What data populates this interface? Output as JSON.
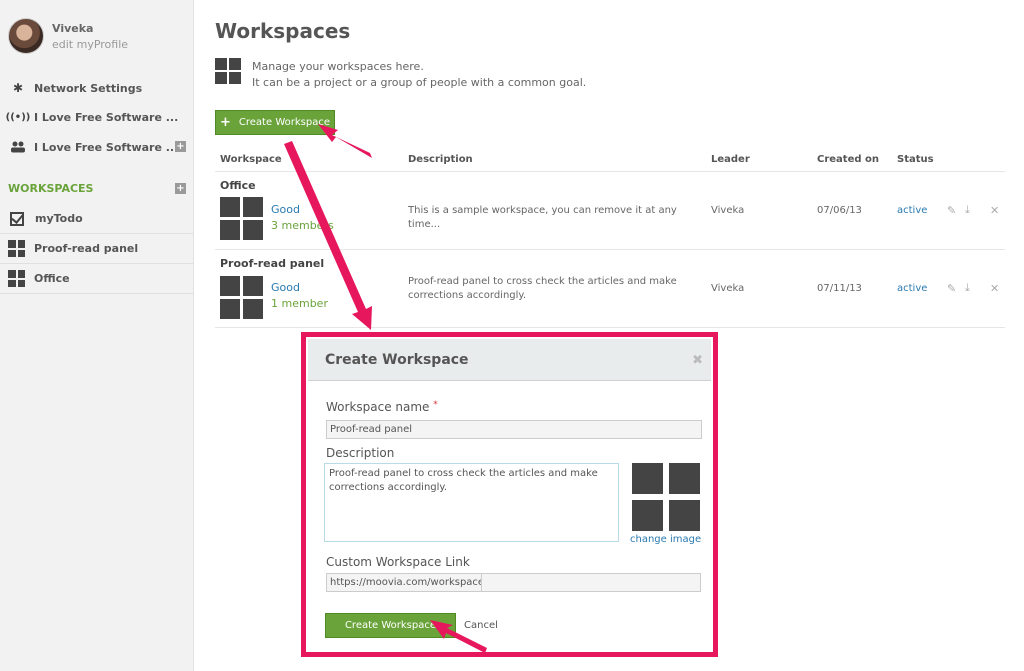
{
  "sidebar": {
    "profile": {
      "name": "Viveka",
      "edit_link": "edit myProfile"
    },
    "items": [
      {
        "label": "Network Settings",
        "icon": "gear-icon"
      },
      {
        "label": "I Love Free Software ...",
        "icon": "wifi-icon"
      },
      {
        "label": "I Love Free Software ...",
        "icon": "people-icon"
      }
    ],
    "workspaces_heading": "WORKSPACES",
    "workspaces": [
      {
        "label": "myTodo",
        "icon": "checkbox-icon"
      },
      {
        "label": "Proof-read panel",
        "icon": "grid-icon"
      },
      {
        "label": "Office",
        "icon": "grid-icon"
      }
    ],
    "plus_glyph": "+"
  },
  "main": {
    "title": "Workspaces",
    "intro_line1": "Manage your workspaces here.",
    "intro_line2": "It can be a project or a group of people with a common goal.",
    "create_button": "Create Workspace",
    "columns": [
      "Workspace",
      "Description",
      "Leader",
      "Created on",
      "Status"
    ],
    "rows": [
      {
        "name": "Office",
        "rating": "Good",
        "members": "3 members",
        "description": "This is a sample workspace, you can remove it at any time...",
        "leader": "Viveka",
        "created": "07/06/13",
        "status": "active"
      },
      {
        "name": "Proof-read panel",
        "rating": "Good",
        "members": "1 member",
        "description": "Proof-read panel to cross check the articles and make corrections accordingly.",
        "leader": "Viveka",
        "created": "07/11/13",
        "status": "active"
      }
    ]
  },
  "modal": {
    "title": "Create Workspace",
    "name_label": "Workspace name",
    "required_mark": "*",
    "name_value": "Proof-read panel",
    "description_label": "Description",
    "description_value": "Proof-read panel to cross check the articles and make corrections accordingly.",
    "change_image": "change image",
    "link_label": "Custom Workspace Link",
    "link_prefix": "https://moovia.com/workspace/",
    "link_value": "",
    "submit": "Create Workspace",
    "cancel": "Cancel"
  },
  "colors": {
    "accent_green": "#6aa33a",
    "link_blue": "#2a7ab0",
    "highlight_pink": "#e6175c"
  }
}
